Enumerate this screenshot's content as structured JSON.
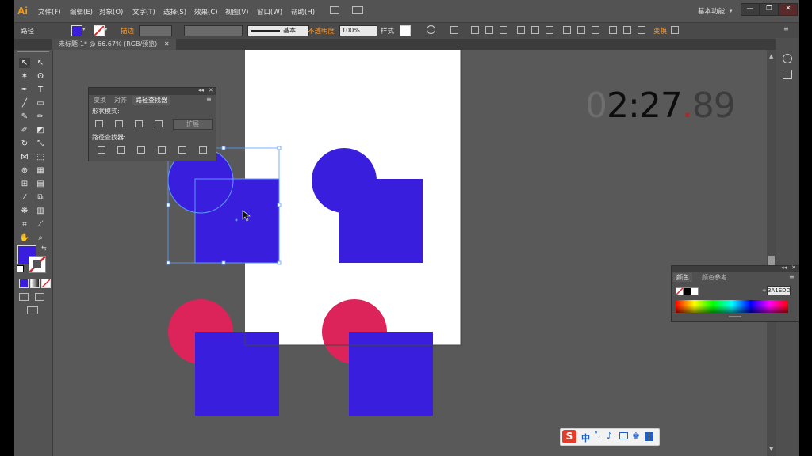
{
  "app": {
    "logo": "Ai",
    "menus": [
      "文件(F)",
      "编辑(E)",
      "对象(O)",
      "文字(T)",
      "选择(S)",
      "效果(C)",
      "视图(V)",
      "窗口(W)",
      "帮助(H)"
    ],
    "workspace": "基本功能",
    "window_buttons": [
      "—",
      "❐",
      "✕"
    ]
  },
  "control_bar": {
    "selection_label": "路径",
    "stroke_label": "描边",
    "stroke_style": "基本",
    "opacity_label": "不透明度",
    "opacity_value": "100%",
    "style_label": "样式",
    "transform_label": "变换"
  },
  "document_tab": {
    "label": "未标题-1* @ 66.67% (RGB/预览)",
    "close": "✕"
  },
  "pathfinder_panel": {
    "tabs": [
      "变换",
      "对齐",
      "路径查找器"
    ],
    "shape_modes_label": "形状模式:",
    "expand_label": "扩展",
    "pathfinders_label": "路径查找器:"
  },
  "color_panel": {
    "tabs": [
      "颜色",
      "颜色参考"
    ],
    "hex_value": "3A1EDD"
  },
  "timer": {
    "faded_prefix": "0",
    "main": "2:27",
    "dot": ".",
    "fraction": "89"
  },
  "ime": {
    "logo": "S",
    "lang": "中"
  },
  "colors": {
    "fill": "#3A1EDD",
    "circle_pink": "#DD245A",
    "canvas": "#595959",
    "ui_bg": "#535353",
    "accent_orange": "#FF9A2E"
  }
}
